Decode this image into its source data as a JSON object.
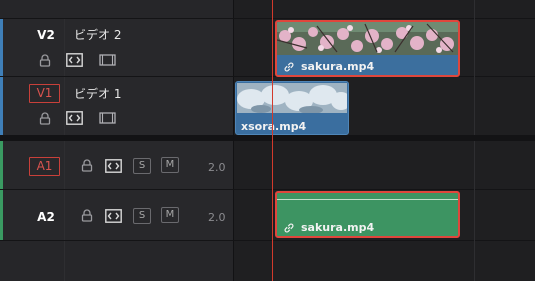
{
  "tracks": {
    "v2": {
      "name": "V2",
      "title": "ビデオ 2"
    },
    "v1": {
      "name": "V1",
      "title": "ビデオ 1"
    },
    "a1": {
      "name": "A1",
      "solo": "S",
      "mute": "M",
      "level": "2.0"
    },
    "a2": {
      "name": "A2",
      "solo": "S",
      "mute": "M",
      "level": "2.0"
    }
  },
  "clips": {
    "v2_clip": {
      "label": "sakura.mp4",
      "linked": true
    },
    "v1_clip": {
      "label": "xsora.mp4",
      "linked": false
    },
    "a2_clip": {
      "label": "sakura.mp4",
      "linked": true
    }
  },
  "colors": {
    "video_accent": "#3f7fb8",
    "audio_accent": "#3a9a62",
    "playhead": "#d23a2c",
    "selection": "#e0463c"
  },
  "icons": [
    "lock-icon",
    "auto-select-icon",
    "monitor-icon",
    "link-icon"
  ]
}
